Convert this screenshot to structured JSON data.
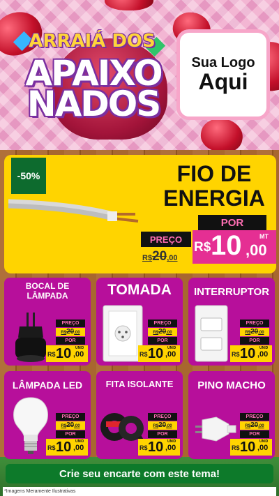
{
  "header": {
    "title_line1": "ARRAIÁ DOS",
    "title_line2": "APAIXO",
    "title_line3": "NADOS",
    "logo_line1": "Sua Logo",
    "logo_line2": "Aqui"
  },
  "feature": {
    "discount": "-50%",
    "title": "FIO DE ENERGIA",
    "por": "POR",
    "preco_label": "PREÇO",
    "old_currency": "R$",
    "old_int": "20",
    "old_cents": ",00",
    "new_currency": "R$",
    "new_int": "10",
    "new_cents": ",00",
    "unit": "MT"
  },
  "products": [
    {
      "name": "BOCAL DE LÂMPADA",
      "preco_label": "PREÇO",
      "old_currency": "R$",
      "old_int": "20",
      "old_cents": ",00",
      "por": "POR",
      "new_currency": "R$",
      "new_int": "10",
      "new_cents": ",00",
      "unit": "UNID"
    },
    {
      "name": "TOMADA",
      "preco_label": "PREÇO",
      "old_currency": "R$",
      "old_int": "20",
      "old_cents": ",00",
      "por": "POR",
      "new_currency": "R$",
      "new_int": "10",
      "new_cents": ",00",
      "unit": "UNID"
    },
    {
      "name": "INTERRUPTOR",
      "preco_label": "PREÇO",
      "old_currency": "R$",
      "old_int": "20",
      "old_cents": ",00",
      "por": "POR",
      "new_currency": "R$",
      "new_int": "10",
      "new_cents": ",00",
      "unit": "UNID"
    },
    {
      "name": "LÂMPADA LED",
      "preco_label": "PREÇO",
      "old_currency": "R$",
      "old_int": "20",
      "old_cents": ",00",
      "por": "POR",
      "new_currency": "R$",
      "new_int": "10",
      "new_cents": ",00",
      "unit": "UNID"
    },
    {
      "name": "FITA ISOLANTE",
      "preco_label": "PREÇO",
      "old_currency": "R$",
      "old_int": "20",
      "old_cents": ",00",
      "por": "POR",
      "new_currency": "R$",
      "new_int": "10",
      "new_cents": ",00",
      "unit": "UNID"
    },
    {
      "name": "PINO MACHO",
      "preco_label": "PREÇO",
      "old_currency": "R$",
      "old_int": "20",
      "old_cents": ",00",
      "por": "POR",
      "new_currency": "R$",
      "new_int": "10",
      "new_cents": ",00",
      "unit": "UNID"
    }
  ],
  "footer": {
    "cta": "Crie seu encarte com este tema!",
    "disclaimer": "*Imagens Meramente Ilustrativas"
  },
  "colors": {
    "card_bg": "#b70f9b",
    "feature_bg": "#ffd400",
    "price_pink": "#e52f93",
    "cta_green": "#0d7a2a"
  }
}
